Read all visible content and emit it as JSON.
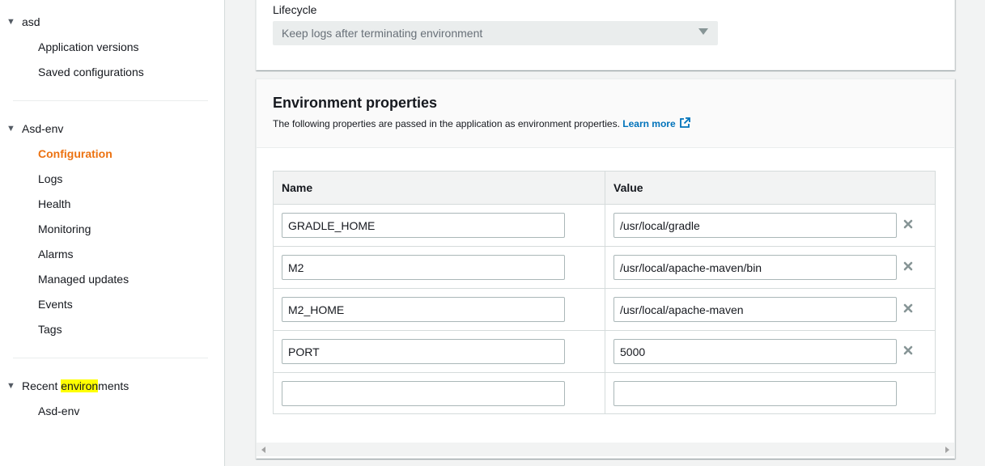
{
  "sidebar": {
    "app_group": {
      "label": "asd",
      "items": [
        "Application versions",
        "Saved configurations"
      ]
    },
    "env_group": {
      "label": "Asd-env",
      "items": [
        "Configuration",
        "Logs",
        "Health",
        "Monitoring",
        "Alarms",
        "Managed updates",
        "Events",
        "Tags"
      ],
      "active": "Configuration"
    },
    "recent_group": {
      "label_before": "Recent ",
      "label_highlight": "environ",
      "label_after": "ments",
      "items": [
        "Asd-env"
      ]
    }
  },
  "lifecycle": {
    "label": "Lifecycle",
    "selected": "Keep logs after terminating environment"
  },
  "env_properties": {
    "title": "Environment properties",
    "description": "The following properties are passed in the application as environment properties.",
    "learn_more": "Learn more",
    "columns": {
      "name": "Name",
      "value": "Value"
    },
    "rows": [
      {
        "name": "GRADLE_HOME",
        "value": "/usr/local/gradle"
      },
      {
        "name": "M2",
        "value": "/usr/local/apache-maven/bin"
      },
      {
        "name": "M2_HOME",
        "value": "/usr/local/apache-maven"
      },
      {
        "name": "PORT",
        "value": "5000"
      },
      {
        "name": "",
        "value": ""
      }
    ]
  },
  "icons": {
    "delete": "close-icon",
    "external": "external-link-icon",
    "expand": "caret-down-icon"
  },
  "colors": {
    "active": "#ec7211",
    "link": "#0073bb",
    "highlight": "#ffff00"
  }
}
